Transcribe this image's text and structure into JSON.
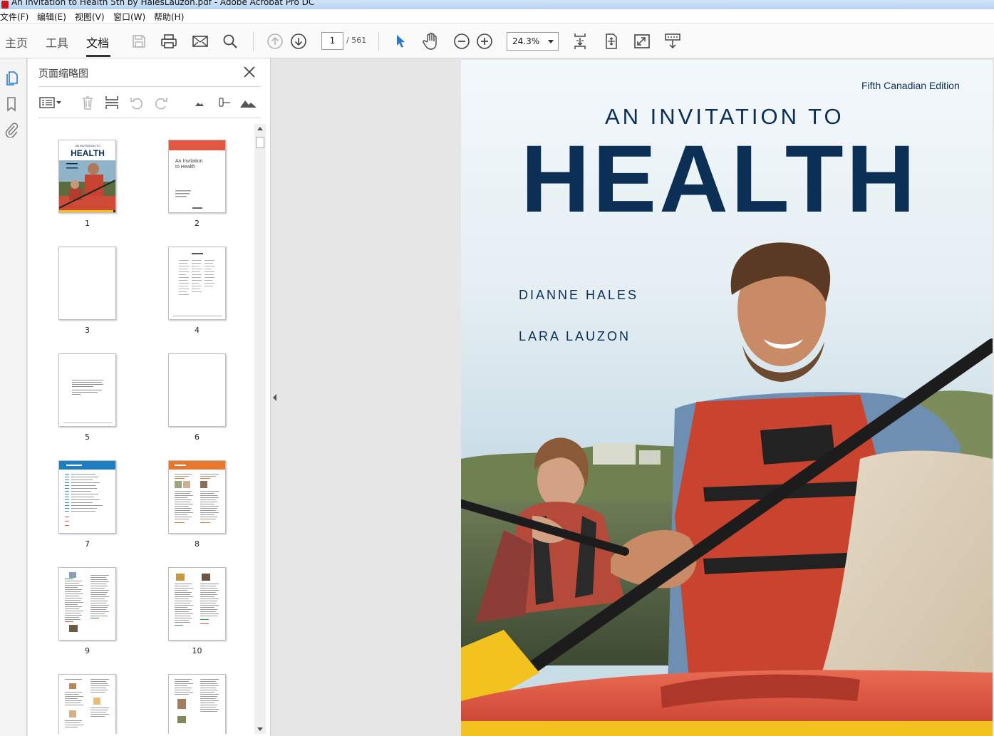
{
  "window": {
    "title": "An Invitation to Health 5th by HalesLauzon.pdf - Adobe Acrobat Pro DC"
  },
  "menu": [
    "文件(F)",
    "编辑(E)",
    "视图(V)",
    "窗口(W)",
    "帮助(H)"
  ],
  "toolbar": {
    "tabs": [
      "主页",
      "工具",
      "文档"
    ],
    "active_tab": "文档",
    "page_current": "1",
    "page_total": "/ 561",
    "zoom": "24.3%"
  },
  "thumbnails_panel": {
    "title": "页面缩略图",
    "pages": [
      "1",
      "2",
      "3",
      "4",
      "5",
      "6",
      "7",
      "8",
      "9",
      "10"
    ]
  },
  "cover": {
    "edition": "Fifth Canadian Edition",
    "invitation": "AN INVITATION TO",
    "title": "HEALTH",
    "author1": "DIANNE HALES",
    "author2": "LARA LAUZON"
  },
  "colors": {
    "cover_navy": "#0b2f55",
    "accent_orange": "#e2583e",
    "selection_blue": "#2a7ad5"
  }
}
